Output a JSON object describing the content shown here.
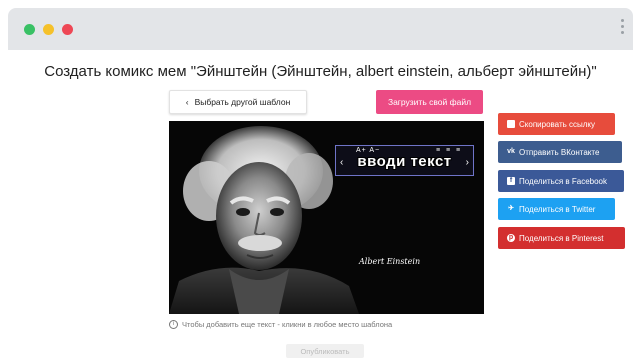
{
  "page": {
    "title": "Создать комикс мем \"Эйнштейн (Эйнштейн, albert einstein, альберт эйнштейн)\""
  },
  "toolbar": {
    "back_label": "Выбрать другой шаблон",
    "back_icon": "chevron-left-icon",
    "upload_label": "Загрузить свой файл"
  },
  "editor": {
    "textbox_text": "вводи текст",
    "size_controls": "A+ A−",
    "align_controls": "≡ ≡ ≡",
    "arrow_left": "‹",
    "arrow_right": "›",
    "signature": "Albert Einstein"
  },
  "hint": {
    "text": "Чтобы добавить еще текст - кликни в любое место шаблона",
    "icon": "i"
  },
  "publish": {
    "label": "Опубликовать"
  },
  "share": {
    "copy_label": "Скопировать ссылку",
    "vk_label": "Отправить ВКонтакте",
    "fb_label": "Поделиться в Facebook",
    "tw_label": "Поделиться в Twitter",
    "pin_label": "Поделиться в Pinterest"
  },
  "colors": {
    "upload": "#ec4b84",
    "copy": "#e74c3c",
    "vk": "#3d5d8f",
    "facebook": "#3b5998",
    "twitter": "#1da1f2",
    "pinterest": "#d32f2f"
  }
}
